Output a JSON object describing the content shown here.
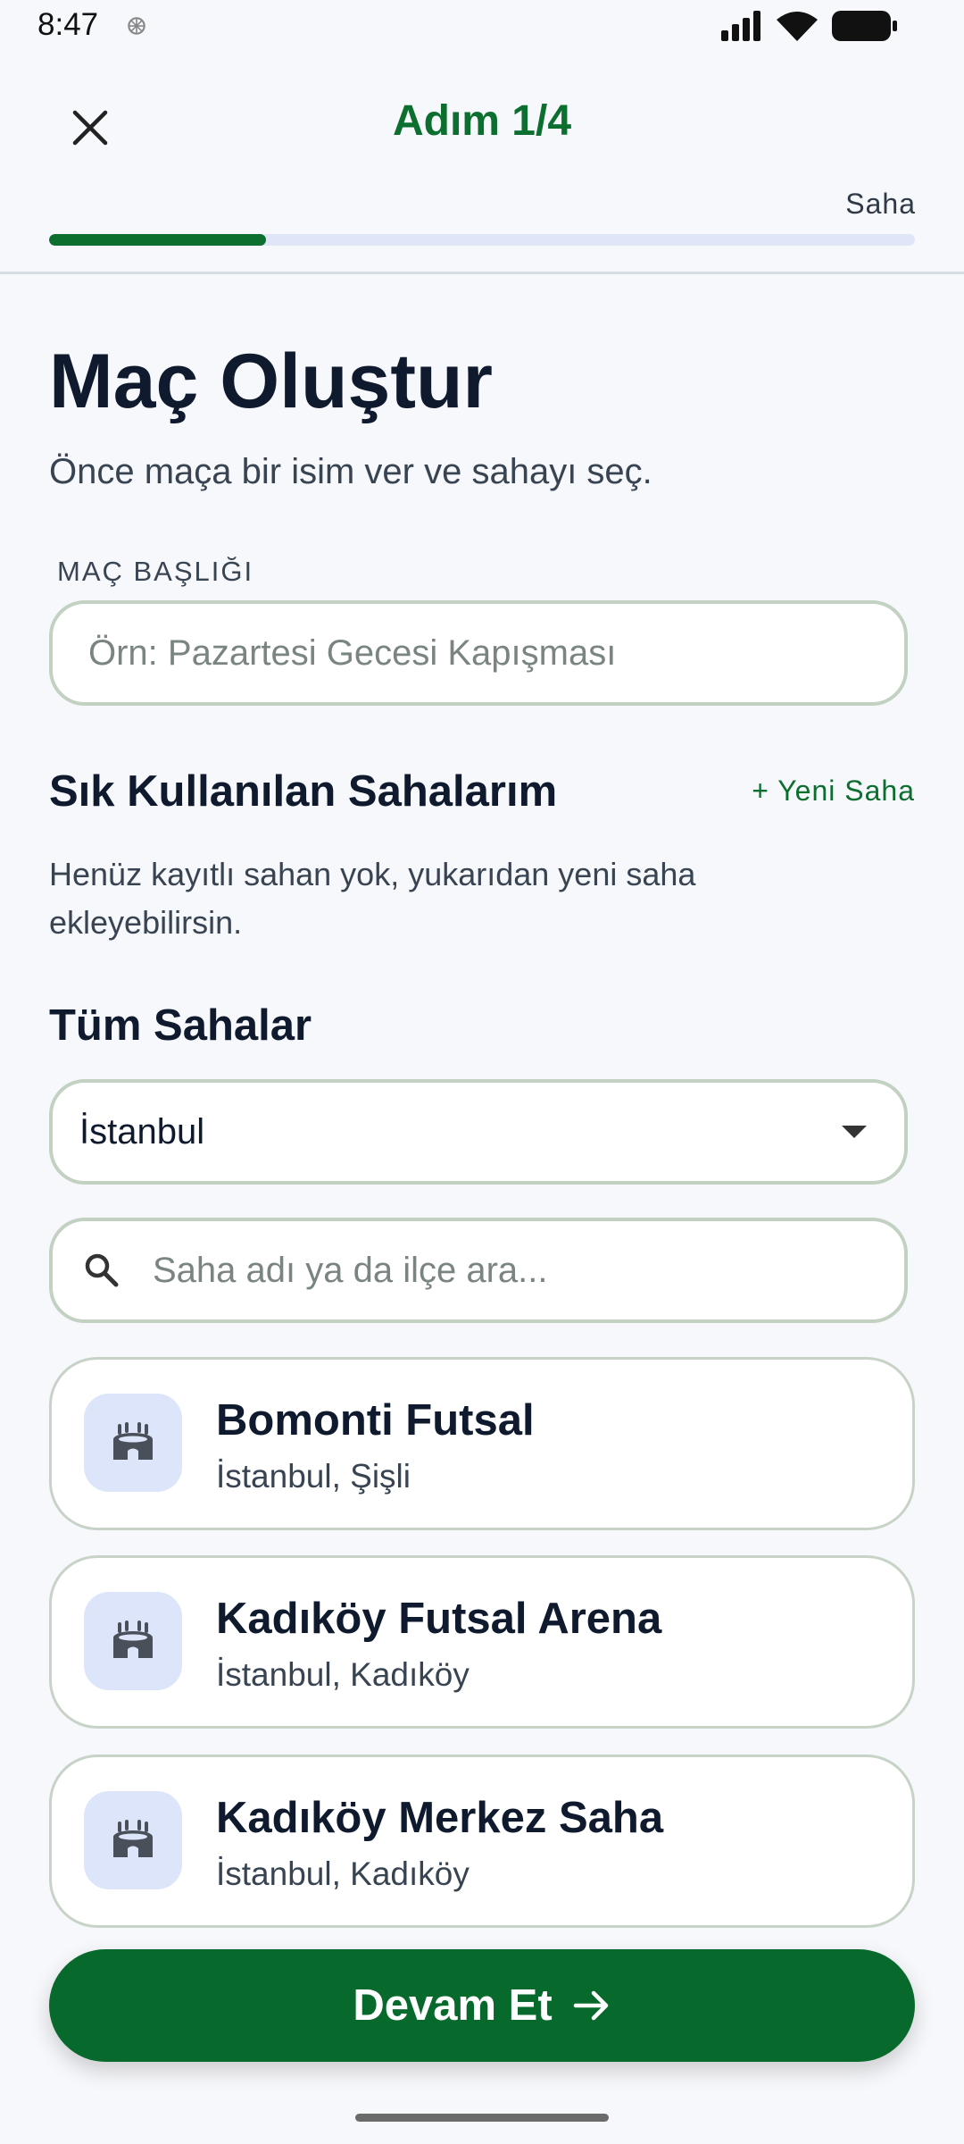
{
  "status_bar": {
    "time": "8:47"
  },
  "header": {
    "step_title": "Adım 1/4",
    "step_label": "Saha",
    "progress": 0.25
  },
  "main": {
    "title": "Maç Oluştur",
    "subtitle": "Önce maça bir isim ver ve sahayı seç.",
    "match_title_label": "MAÇ BAŞLIĞI",
    "match_title_value": "",
    "match_title_placeholder": "Örn: Pazartesi Gecesi Kapışması"
  },
  "favorites": {
    "title": "Sık Kullanılan Sahalarım",
    "add_label": "+ Yeni Saha",
    "empty_text": "Henüz kayıtlı sahan yok, yukarıdan yeni saha ekleyebilirsin."
  },
  "all_venues": {
    "title": "Tüm Sahalar",
    "city_selected": "İstanbul",
    "search_placeholder": "Saha adı ya da ilçe ara...",
    "venues": [
      {
        "name": "Bomonti Futsal",
        "location": "İstanbul, Şişli"
      },
      {
        "name": "Kadıköy Futsal Arena",
        "location": "İstanbul, Kadıköy"
      },
      {
        "name": "Kadıköy Merkez Saha",
        "location": "İstanbul, Kadıköy"
      }
    ]
  },
  "footer": {
    "continue_label": "Devam Et"
  },
  "colors": {
    "primary": "#0c6e2f",
    "button": "#076a2c",
    "progress_track": "#dfe6f7",
    "thumb_bg": "#dde5fb"
  },
  "icons": {
    "close": "close-icon",
    "search": "search-icon",
    "dropdown": "chevron-down-icon",
    "stadium": "stadium-icon",
    "arrow": "arrow-right-icon"
  }
}
